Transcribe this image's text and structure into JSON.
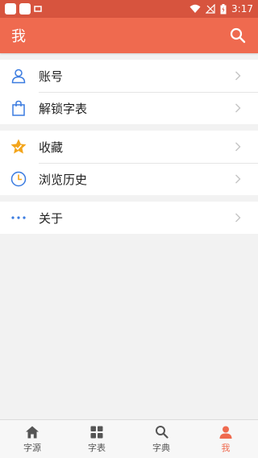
{
  "status": {
    "time": "3:17"
  },
  "appbar": {
    "title": "我",
    "accent": "#ef6a4f"
  },
  "groups": [
    {
      "items": [
        {
          "label": "账号",
          "icon": "person-icon"
        },
        {
          "label": "解锁字表",
          "icon": "bag-icon"
        }
      ]
    },
    {
      "items": [
        {
          "label": "收藏",
          "icon": "star-icon"
        },
        {
          "label": "浏览历史",
          "icon": "clock-icon"
        }
      ]
    },
    {
      "items": [
        {
          "label": "关于",
          "icon": "more-dots-icon"
        }
      ]
    }
  ],
  "nav": [
    {
      "label": "字源",
      "icon": "home-icon"
    },
    {
      "label": "字表",
      "icon": "grid-icon"
    },
    {
      "label": "字典",
      "icon": "search-icon"
    },
    {
      "label": "我",
      "icon": "person-icon",
      "active": true
    }
  ]
}
